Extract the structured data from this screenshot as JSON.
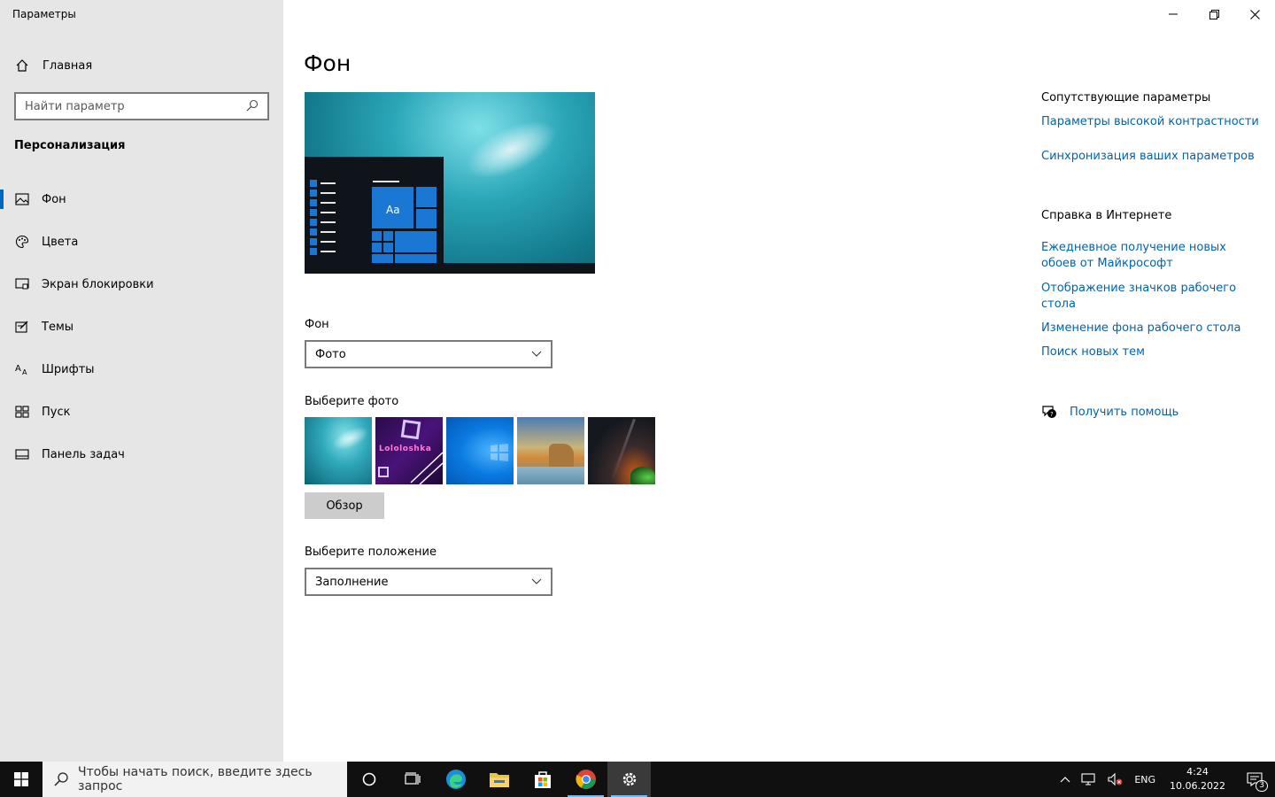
{
  "window": {
    "title": "Параметры",
    "minimize_icon": "minimize-icon",
    "maximize_icon": "restore-icon",
    "close_icon": "close-icon"
  },
  "sidebar": {
    "home_label": "Главная",
    "search_placeholder": "Найти параметр",
    "section_title": "Персонализация",
    "items": [
      {
        "label": "Фон",
        "icon": "picture-icon",
        "active": true
      },
      {
        "label": "Цвета",
        "icon": "palette-icon",
        "active": false
      },
      {
        "label": "Экран блокировки",
        "icon": "lock-screen-icon",
        "active": false
      },
      {
        "label": "Темы",
        "icon": "themes-icon",
        "active": false
      },
      {
        "label": "Шрифты",
        "icon": "fonts-icon",
        "active": false
      },
      {
        "label": "Пуск",
        "icon": "start-icon",
        "active": false
      },
      {
        "label": "Панель задач",
        "icon": "taskbar-icon",
        "active": false
      }
    ]
  },
  "main": {
    "title": "Фон",
    "preview_tile_label": "Aa",
    "background_label": "Фон",
    "background_value": "Фото",
    "choose_photo_label": "Выберите фото",
    "browse_label": "Обзор",
    "thumb5_text": "Lololoshka",
    "position_label": "Выберите положение",
    "position_value": "Заполнение"
  },
  "related": {
    "heading1": "Сопутствующие параметры",
    "link1": "Параметры высокой контрастности",
    "link2": "Синхронизация ваших параметров",
    "heading2": "Справка в Интернете",
    "link3": "Ежедневное получение новых обоев от Майкрософт",
    "link4": "Отображение значков рабочего стола",
    "link5": "Изменение фона рабочего стола",
    "link6": "Поиск новых тем",
    "help_label": "Получить помощь"
  },
  "taskbar": {
    "search_placeholder": "Чтобы начать поиск, введите здесь запрос",
    "lang": "ENG",
    "time": "4:24",
    "date": "10.06.2022",
    "notification_count": "3"
  },
  "colors": {
    "accent": "#0067c0",
    "link": "#0063b1",
    "sidebar_bg": "#e6e6e6",
    "taskbar_bg": "#101010"
  }
}
